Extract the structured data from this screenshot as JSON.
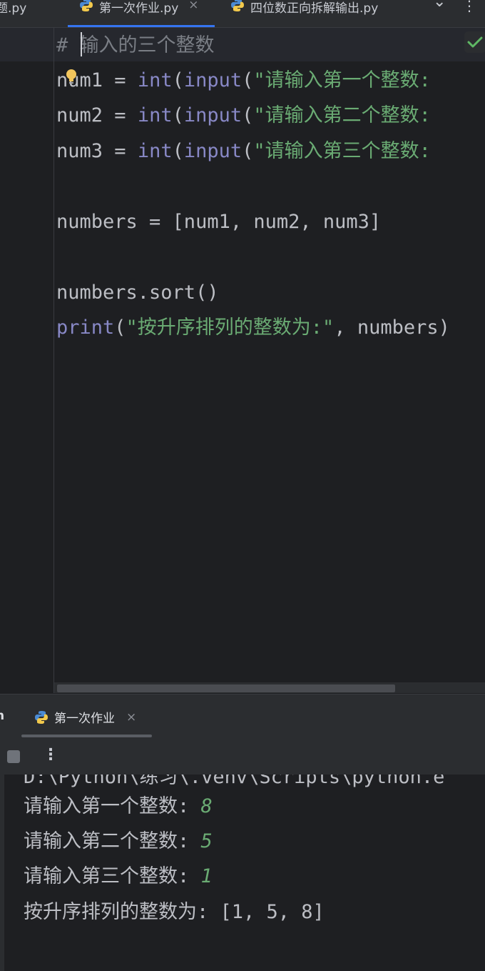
{
  "tabs": [
    {
      "label": "题.py",
      "active": false,
      "closable": false
    },
    {
      "label": "第一次作业.py",
      "active": true,
      "closable": true
    },
    {
      "label": "四位数正向拆解输出.py",
      "active": false,
      "closable": false
    }
  ],
  "tab_close_glyph": "×",
  "tab_overflow_glyph": "⌄",
  "tab_menu_glyph": "⋮",
  "editor": {
    "comment": "# 输入的三个整数",
    "lines": {
      "l1": {
        "var": "num1",
        "op": " = ",
        "fn1": "int",
        "p1": "(",
        "fn2": "input",
        "p2": "(",
        "str": "\"请输入第一个整数: "
      },
      "l2": {
        "var": "num2",
        "op": " = ",
        "fn1": "int",
        "p1": "(",
        "fn2": "input",
        "p2": "(",
        "str": "\"请输入第二个整数: "
      },
      "l3": {
        "var": "num3",
        "op": " = ",
        "fn1": "int",
        "p1": "(",
        "fn2": "input",
        "p2": "(",
        "str": "\"请输入第三个整数: "
      },
      "l5": "numbers = [num1, num2, num3]",
      "l7": "numbers.sort()",
      "l8": {
        "fn": "print",
        "p": "(",
        "str": "\"按升序排列的整数为:\"",
        "rest": ", numbers)"
      }
    }
  },
  "run_panel": {
    "side_label": "n",
    "tab_label": "第一次作业",
    "more_glyph": "⋮",
    "console": {
      "cut_line": "D:\\Python\\练习\\.venv\\Scripts\\python.e",
      "prompts": [
        {
          "prompt": "请输入第一个整数: ",
          "input": "8"
        },
        {
          "prompt": "请输入第二个整数: ",
          "input": "5"
        },
        {
          "prompt": "请输入第三个整数: ",
          "input": "1"
        }
      ],
      "result": "按升序排列的整数为: [1, 5, 8]"
    }
  },
  "colors": {
    "accent": "#3574f0",
    "string": "#6aab73",
    "builtin": "#8888c6",
    "comment": "#7a7e85",
    "check": "#5fb865",
    "bulb": "#f2c55c"
  }
}
